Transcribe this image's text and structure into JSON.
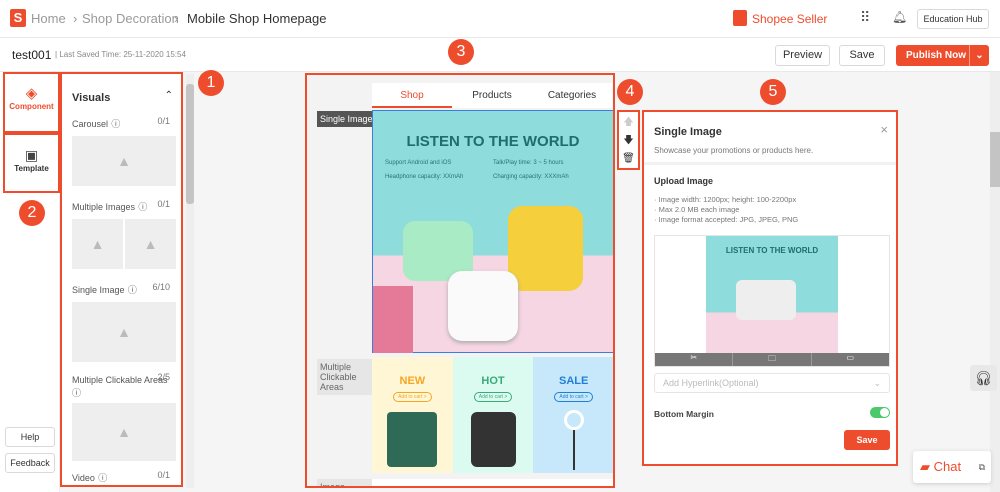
{
  "breadcrumb": {
    "home": "Home",
    "shop_decoration": "Shop Decoration",
    "current": "Mobile Shop Homepage"
  },
  "header": {
    "brand": "Shopee Seller",
    "education_hub": "Education Hub"
  },
  "toolbar": {
    "page_name": "test001",
    "last_saved": "Last Saved Time: 25-11-2020 15:54",
    "preview": "Preview",
    "save": "Save",
    "publish": "Publish Now"
  },
  "rail": {
    "component": "Component",
    "template": "Template",
    "help": "Help",
    "feedback": "Feedback"
  },
  "panel": {
    "title": "Visuals",
    "items": [
      {
        "label": "Carousel",
        "count": "0/1"
      },
      {
        "label": "Multiple Images",
        "count": "0/1"
      },
      {
        "label": "Single Image",
        "count": "6/10"
      },
      {
        "label": "Multiple Clickable Areas",
        "count": "2/5"
      },
      {
        "label": "Video",
        "count": "0/1"
      }
    ]
  },
  "preview": {
    "tabs": [
      "Shop",
      "Products",
      "Categories"
    ],
    "labels": {
      "single_image": "Single Image",
      "multi": "Multiple Clickable Areas",
      "image": "Image"
    },
    "banner": {
      "title": "LISTEN TO THE WORLD",
      "features": [
        "Support Android and iOS",
        "Talk/Play time: 3 ~ 5 hours",
        "Headphone capacity: XXmAh",
        "Charging capacity: XXXmAh"
      ]
    },
    "areas": [
      {
        "title": "NEW",
        "cta": "Add to cart >",
        "color": "#f5a623"
      },
      {
        "title": "HOT",
        "cta": "Add to cart >",
        "color": "#3aaa7a"
      },
      {
        "title": "SALE",
        "cta": "Add to cart >",
        "color": "#1f7fd6"
      }
    ]
  },
  "editor": {
    "title": "Single Image",
    "subtitle": "Showcase your promotions or products here.",
    "upload_title": "Upload Image",
    "rules": [
      "Image width: 1200px; height: 100-2200px",
      "Max 2.0 MB each image",
      "Image format accepted: JPG, JPEG, PNG"
    ],
    "thumb_title": "LISTEN TO THE WORLD",
    "hyperlink_placeholder": "Add Hyperlink(Optional)",
    "bottom_margin": "Bottom Margin",
    "bottom_margin_on": true,
    "save": "Save"
  },
  "badges": [
    "1",
    "2",
    "3",
    "4",
    "5"
  ],
  "chat": {
    "label": "Chat"
  },
  "colors": {
    "accent": "#ee4d2d",
    "toggle": "#4cc96b"
  }
}
